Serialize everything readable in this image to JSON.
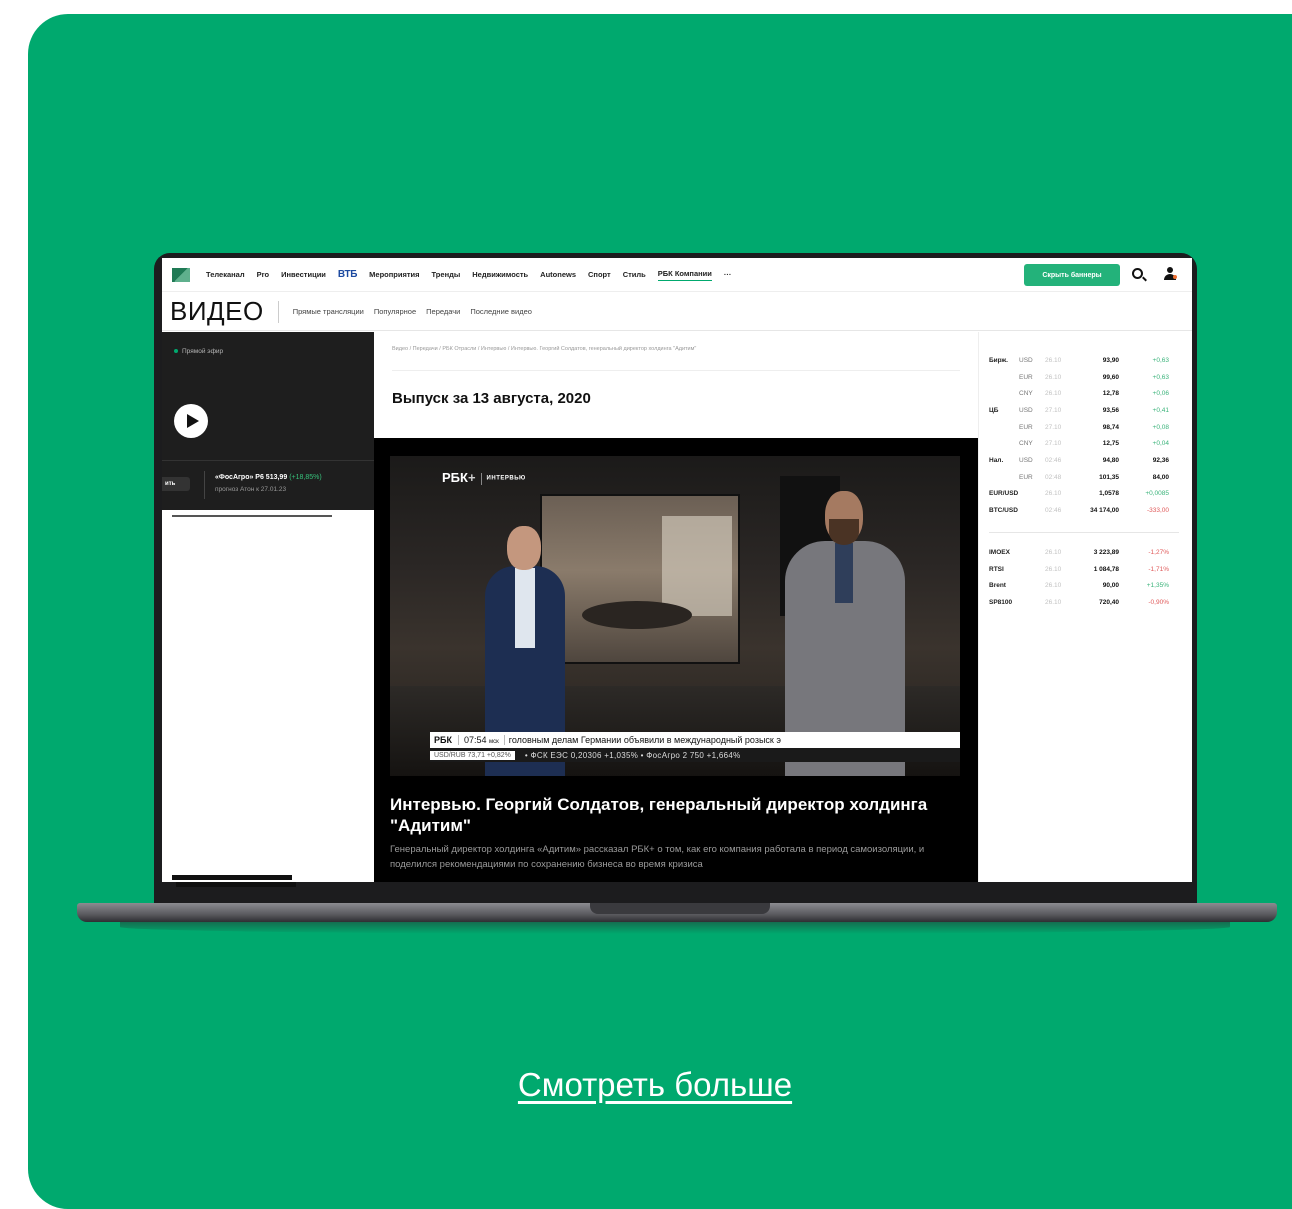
{
  "nav": {
    "items": [
      "Телеканал",
      "Pro",
      "Инвестиции",
      "ВТБ",
      "Мероприятия",
      "Тренды",
      "Недвижимость",
      "Autonews",
      "Спорт",
      "Стиль",
      "РБК Компании",
      "···"
    ],
    "hide_banners": "Скрыть баннеры"
  },
  "section": {
    "title": "ВИДЕО",
    "tabs": [
      "Прямые трансляции",
      "Популярное",
      "Передачи",
      "Последние видео"
    ]
  },
  "live": {
    "label": "Прямой эфир"
  },
  "ad": {
    "button": "ить",
    "headline": "«ФосАгро» Р6 513,99",
    "change": "(+18,85%)",
    "sub": "прогноз Атон к 27.01.23"
  },
  "content": {
    "breadcrumbs": "Видео / Передачи / РБК Отрасли / Интервью / Интервью. Георгий Солдатов, генеральный директор холдинга \"Адитим\"",
    "episode": "Выпуск за 13 августа, 2020",
    "video": {
      "brand": "РБК",
      "brand_plus": "+",
      "brand_tag": "ИНТЕРВЬЮ",
      "ticker_logo": "РБК",
      "ticker_time": "07:54",
      "ticker_tz": "мск",
      "ticker_news": "головным делам Германии объявили в международный розыск э",
      "rate": "USD/RUB 73,71 +0,82%",
      "market": "•   ФСК ЕЭС  0,20306  +1,035%   •   ФосАгро  2 750  +1,664%"
    },
    "title": "Интервью. Георгий Солдатов, генеральный директор холдинга \"Адитим\"",
    "description": "Генеральный директор холдинга «Адитим» рассказал РБК+ о том, как его компания работала в период самоизоляции, и поделился рекомендациями по сохранению бизнеса во время кризиса"
  },
  "rates": {
    "rows": [
      {
        "group": "Бирж.",
        "cur": "USD",
        "date": "26.10",
        "value": "93,90",
        "change": "+0,63",
        "dir": "up"
      },
      {
        "group": "",
        "cur": "EUR",
        "date": "26.10",
        "value": "99,60",
        "change": "+0,63",
        "dir": "up"
      },
      {
        "group": "",
        "cur": "CNY",
        "date": "26.10",
        "value": "12,78",
        "change": "+0,06",
        "dir": "up"
      },
      {
        "group": "ЦБ",
        "cur": "USD",
        "date": "27.10",
        "value": "93,56",
        "change": "+0,41",
        "dir": "up"
      },
      {
        "group": "",
        "cur": "EUR",
        "date": "27.10",
        "value": "98,74",
        "change": "+0,08",
        "dir": "up"
      },
      {
        "group": "",
        "cur": "CNY",
        "date": "27.10",
        "value": "12,75",
        "change": "+0,04",
        "dir": "up"
      },
      {
        "group": "Нал.",
        "cur": "USD",
        "date": "02:46",
        "value": "94,80",
        "change": "92,36",
        "dir": "bk"
      },
      {
        "group": "",
        "cur": "EUR",
        "date": "02:48",
        "value": "101,35",
        "change": "84,00",
        "dir": "bk"
      },
      {
        "group": "EUR/USD",
        "cur": "",
        "date": "26.10",
        "value": "1,0578",
        "change": "+0,0085",
        "dir": "up"
      },
      {
        "group": "BTC/USD",
        "cur": "",
        "date": "02:46",
        "value": "34 174,00",
        "change": "-333,00",
        "dir": "dn"
      }
    ],
    "indices": [
      {
        "name": "IMOEX",
        "date": "26.10",
        "value": "3 223,89",
        "change": "-1,27%",
        "dir": "dn"
      },
      {
        "name": "RTSI",
        "date": "26.10",
        "value": "1 084,78",
        "change": "-1,71%",
        "dir": "dn"
      },
      {
        "name": "Brent",
        "date": "26.10",
        "value": "90,00",
        "change": "+1,35%",
        "dir": "up"
      },
      {
        "name": "SP8100",
        "date": "26.10",
        "value": "720,40",
        "change": "-0,90%",
        "dir": "dn"
      }
    ]
  },
  "cta": "Смотреть больше",
  "colors": {
    "background": "#00a96e",
    "accent": "#23b27a"
  }
}
